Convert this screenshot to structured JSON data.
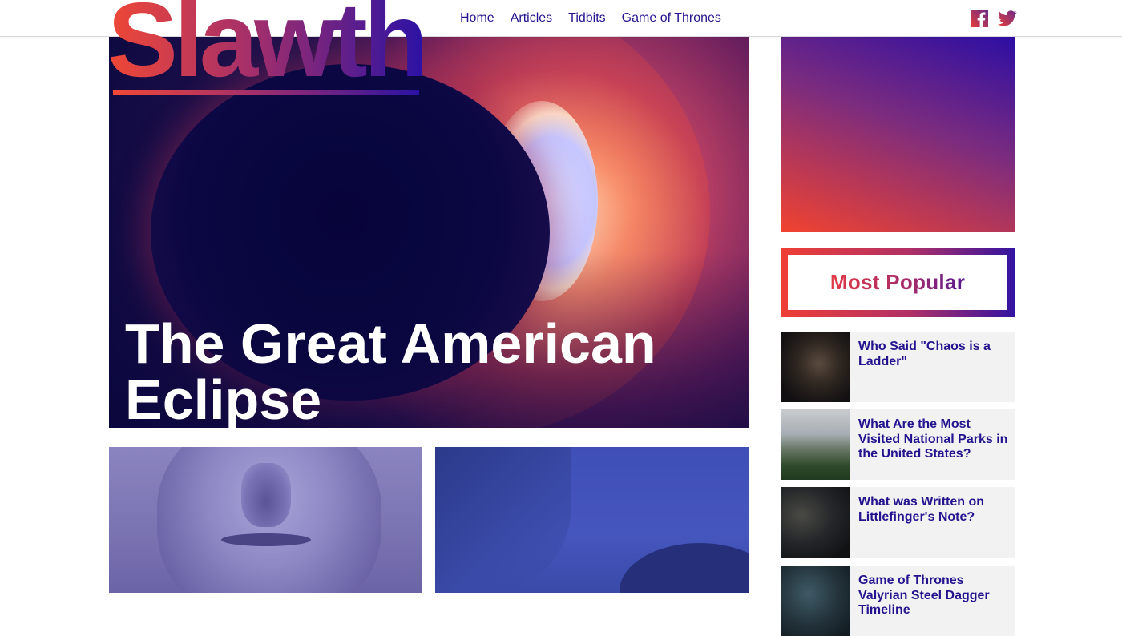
{
  "site": {
    "logo": "Slawth"
  },
  "nav": {
    "items": [
      "Home",
      "Articles",
      "Tidbits",
      "Game of Thrones"
    ]
  },
  "social": {
    "icons": [
      "facebook-icon",
      "twitter-icon"
    ]
  },
  "hero": {
    "title": "The Great American Eclipse"
  },
  "sidebar": {
    "most_popular_title": "Most Popular",
    "popular": [
      {
        "title": "Who Said \"Chaos is a Ladder\""
      },
      {
        "title": "What Are the Most Visited National Parks in the United States?"
      },
      {
        "title": "What was Written on Littlefinger's Note?"
      },
      {
        "title": "Game of Thrones Valyrian Steel Dagger Timeline"
      }
    ]
  },
  "colors": {
    "brand_red": "#f04836",
    "brand_purple": "#2b12a4",
    "link": "#23138f"
  }
}
